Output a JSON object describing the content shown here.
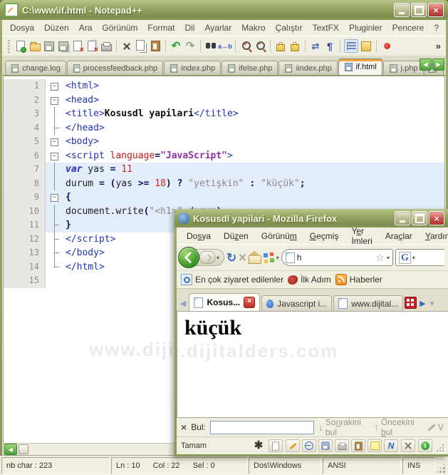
{
  "watermark": "www.dijitalders.com",
  "glyphs": {
    "overflow": "»",
    "close_x": "×",
    "undo": "↶",
    "redo": "↷",
    "wrap": "⇄",
    "pilcrow": "¶",
    "reload": "↻",
    "stop": "×",
    "down_arrow": "↓",
    "up_arrow": "↑",
    "left_tri": "◀",
    "right_tri": "▶",
    "caret": "▾",
    "star": "☆",
    "google_g": "G",
    "spider": "✱",
    "plus": "+",
    "minus": "-"
  },
  "npp": {
    "title": "C:\\www\\if.html - Notepad++",
    "menu": [
      "Dosya",
      "Düzen",
      "Ara",
      "Görünüm",
      "Format",
      "Dil",
      "Ayarlar",
      "Makro",
      "Çalıştır",
      "TextFX",
      "Pluginler",
      "Pencere",
      "?"
    ],
    "toolbar": [
      "new-file",
      "open-folder",
      "save",
      "save-all",
      "close",
      "close-all",
      "print",
      "|",
      "cut",
      "copy",
      "paste",
      "|",
      "undo",
      "redo",
      "|",
      "find",
      "replace",
      "|",
      "zoom-in",
      "zoom-out",
      "|",
      "sync-v",
      "sync-h",
      "|",
      "word-wrap",
      "show-symbols",
      "|",
      "indent-guides",
      "doc-switcher",
      "|",
      "record-macro"
    ],
    "tabs": [
      {
        "label": "change.log",
        "active": false,
        "partial": false
      },
      {
        "label": "processfeedback.php",
        "active": false,
        "partial": false
      },
      {
        "label": "index.php",
        "active": false,
        "partial": false
      },
      {
        "label": "ifelse.php",
        "active": false,
        "partial": false
      },
      {
        "label": "iindex.php",
        "active": false,
        "partial": false
      },
      {
        "label": "if.html",
        "active": true,
        "partial": false
      },
      {
        "label": "j.php",
        "active": false,
        "partial": false
      },
      {
        "label": "",
        "active": false,
        "partial": true
      }
    ],
    "code_lines": [
      {
        "n": "1",
        "fold": "start",
        "hl": false,
        "segs": [
          [
            "tag",
            "<html>"
          ]
        ]
      },
      {
        "n": "2",
        "fold": "start",
        "hl": false,
        "segs": [
          [
            "tag",
            "<head>"
          ]
        ]
      },
      {
        "n": "3",
        "fold": "mid",
        "hl": false,
        "segs": [
          [
            "tag",
            "<title>"
          ],
          [
            "b",
            "Kosusdl yapilari"
          ],
          [
            "tag",
            "</title>"
          ]
        ]
      },
      {
        "n": "4",
        "fold": "tee",
        "hl": false,
        "segs": [
          [
            "tag",
            "</head>"
          ]
        ]
      },
      {
        "n": "5",
        "fold": "start",
        "hl": false,
        "segs": [
          [
            "tag",
            "<body>"
          ]
        ]
      },
      {
        "n": "6",
        "fold": "start",
        "hl": false,
        "segs": [
          [
            "tag",
            "<script "
          ],
          [
            "attr",
            "language"
          ],
          [
            "op",
            "="
          ],
          [
            "val",
            "\"JavaScript\""
          ],
          [
            "tag",
            ">"
          ]
        ]
      },
      {
        "n": "7",
        "fold": "mid",
        "hl": true,
        "segs": [
          [
            "kw",
            "var"
          ],
          [
            "pl",
            " yas "
          ],
          [
            "op",
            "="
          ],
          [
            "pl",
            " "
          ],
          [
            "num",
            "11"
          ]
        ]
      },
      {
        "n": "8",
        "fold": "mid",
        "hl": true,
        "segs": [
          [
            "pl",
            "durum "
          ],
          [
            "op",
            "="
          ],
          [
            "pl",
            " "
          ],
          [
            "op",
            "("
          ],
          [
            "pl",
            "yas "
          ],
          [
            "op",
            ">="
          ],
          [
            "pl",
            " "
          ],
          [
            "num",
            "18"
          ],
          [
            "op",
            ")"
          ],
          [
            "pl",
            " "
          ],
          [
            "op",
            "?"
          ],
          [
            "pl",
            " "
          ],
          [
            "str",
            "\"yetişkin\""
          ],
          [
            "pl",
            " "
          ],
          [
            "op",
            ":"
          ],
          [
            "pl",
            " "
          ],
          [
            "str",
            "\"küçük\""
          ],
          [
            "op",
            ";"
          ]
        ]
      },
      {
        "n": "9",
        "fold": "start",
        "hl": true,
        "segs": [
          [
            "op",
            "{"
          ]
        ]
      },
      {
        "n": "10",
        "fold": "mid",
        "hl": true,
        "segs": [
          [
            "pl",
            "document.write"
          ],
          [
            "op",
            "("
          ],
          [
            "str",
            "\"<h1>\""
          ],
          [
            "op",
            ","
          ],
          [
            "pl",
            "durum"
          ],
          [
            "op",
            ")"
          ]
        ]
      },
      {
        "n": "11",
        "fold": "tee",
        "hl": true,
        "segs": [
          [
            "op",
            "}"
          ]
        ]
      },
      {
        "n": "12",
        "fold": "tee",
        "hl": false,
        "segs": [
          [
            "tag",
            "</script>"
          ]
        ]
      },
      {
        "n": "13",
        "fold": "tee",
        "hl": false,
        "segs": [
          [
            "tag",
            "</body>"
          ]
        ]
      },
      {
        "n": "14",
        "fold": "corner",
        "hl": false,
        "segs": [
          [
            "tag",
            "</html>"
          ]
        ]
      },
      {
        "n": "15",
        "fold": "none",
        "hl": false,
        "segs": []
      }
    ],
    "status": {
      "chars": "nb char : 223",
      "ln": "Ln : 10",
      "col": "Col : 22",
      "sel": "Sel : 0",
      "eol": "Dos\\Windows",
      "encoding": "ANSI",
      "mode": "INS"
    }
  },
  "ff": {
    "title": "Kosusdl yapilari - Mozilla Firefox",
    "menu": [
      {
        "pre": "Do",
        "key": "s",
        "post": "ya"
      },
      {
        "pre": "Dü",
        "key": "z",
        "post": "en"
      },
      {
        "pre": "Görünü",
        "key": "m",
        "post": ""
      },
      {
        "pre": "",
        "key": "G",
        "post": "eçmiş"
      },
      {
        "pre": "Y",
        "key": "e",
        "post": "r İmleri"
      },
      {
        "pre": "Ara",
        "key": "ç",
        "post": "lar"
      },
      {
        "pre": "",
        "key": "Y",
        "post": "ardım"
      }
    ],
    "urlbar_text": "h",
    "bookmarks": [
      {
        "label": "En çok ziyaret edilenler",
        "icon": "most-visited"
      },
      {
        "label": "İlk Adım",
        "icon": "getting-started"
      },
      {
        "label": "Haberler",
        "icon": "rss"
      }
    ],
    "tabs": [
      {
        "label": "Kosus...",
        "active": true,
        "closable": true,
        "icon": "page"
      },
      {
        "label": "Javascript i...",
        "active": false,
        "closable": false,
        "icon": "js"
      },
      {
        "label": "www.dijital...",
        "active": false,
        "closable": false,
        "icon": "page"
      }
    ],
    "content_heading": "küçük",
    "findbar": {
      "label": "Bul:",
      "value": "",
      "next": {
        "pre": "So",
        "key": "n",
        "post": "rakini bul"
      },
      "prev": {
        "pre": "Öncekini ",
        "key": "b",
        "post": "ul"
      },
      "highlight_partial": "V"
    },
    "status_text": "Tamam",
    "status_buttons": [
      "edit",
      "view-source",
      "save-page",
      "print-page",
      "clipboard",
      "note",
      "validator"
    ]
  }
}
